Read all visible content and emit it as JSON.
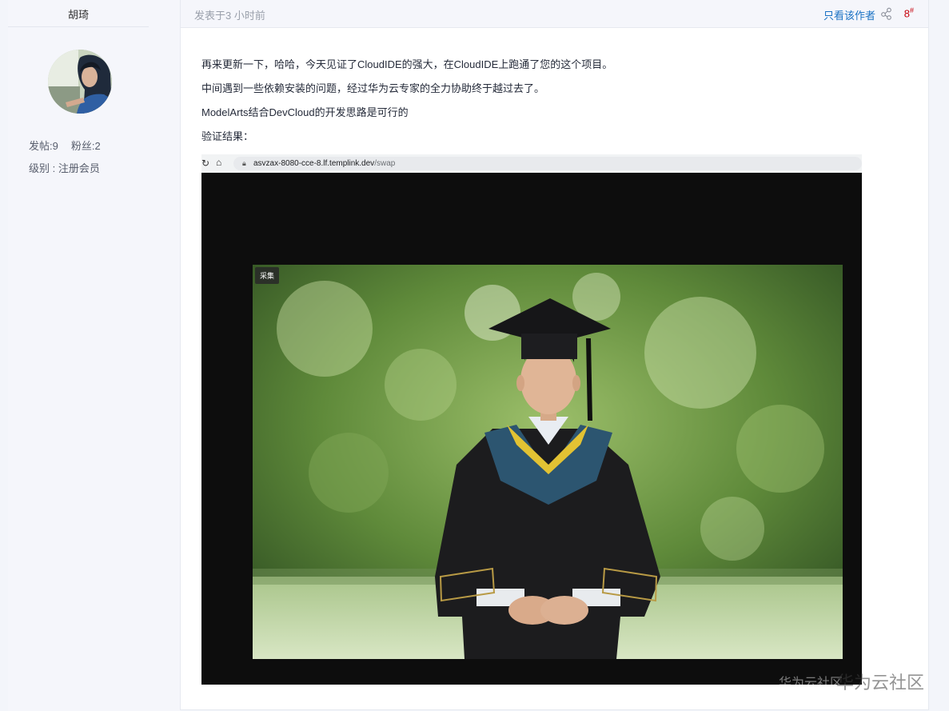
{
  "author": {
    "name": "胡琦",
    "posts_label": "发帖:9",
    "fans_label": "粉丝:2",
    "level_label": "级别 : 注册会员"
  },
  "post": {
    "time": "发表于3 小时前",
    "only_author_label": "只看该作者",
    "floor_number": "8",
    "floor_mark": "#",
    "paragraphs": [
      "再来更新一下，哈哈，今天见证了CloudIDE的强大，在CloudIDE上跑通了您的这个项目。",
      "中间遇到一些依赖安装的问题，经过华为云专家的全力协助终于越过去了。",
      "ModelArts结合DevCloud的开发思路是可行的",
      "验证结果："
    ]
  },
  "screenshot": {
    "url_host": "asvzax-8080-cce-8.lf.templink.dev",
    "url_path": "/swap",
    "capture_badge": "采集",
    "watermark_inner": "华为云社区"
  },
  "watermark_outer": "华为云社区",
  "icons": {
    "reload": "reload-icon",
    "home": "home-icon",
    "lock": "lock-icon",
    "share": "share-icon"
  },
  "colors": {
    "link": "#1a72c4",
    "floor": "#c7000b",
    "sidebar_bg": "#f5f6fb"
  }
}
